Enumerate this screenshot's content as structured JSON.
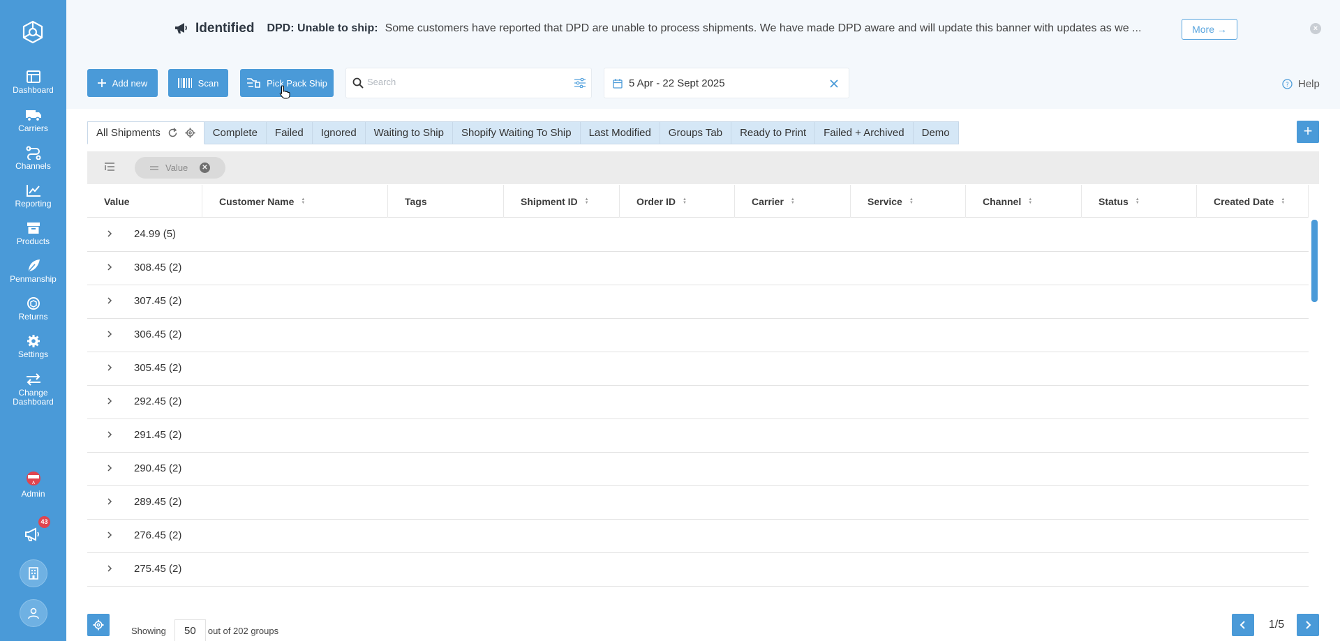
{
  "sidebar": {
    "items": [
      {
        "label": "Dashboard",
        "icon": "dashboard-icon"
      },
      {
        "label": "Carriers",
        "icon": "truck-icon"
      },
      {
        "label": "Channels",
        "icon": "channels-icon"
      },
      {
        "label": "Reporting",
        "icon": "chart-line-icon"
      },
      {
        "label": "Products",
        "icon": "box-icon"
      },
      {
        "label": "Penmanship",
        "icon": "feather-icon"
      },
      {
        "label": "Returns",
        "icon": "returns-icon"
      },
      {
        "label": "Settings",
        "icon": "gear-icon"
      },
      {
        "label": "Change Dashboard",
        "icon": "swap-icon"
      }
    ],
    "admin_label": "Admin",
    "notification_count": "43"
  },
  "banner": {
    "title": "Identified",
    "subtitle": "DPD: Unable to ship:",
    "text": "Some customers have reported that DPD are unable to process shipments. We have made DPD aware and will update this banner with updates as we ...",
    "more_label": "More →",
    "close_label": "×"
  },
  "toolbar": {
    "add_new_label": "Add new",
    "scan_label": "Scan",
    "pick_pack_ship_label": "Pick Pack Ship",
    "search_placeholder": "Search",
    "date_range": "5 Apr - 22 Sept 2025",
    "help_label": "Help"
  },
  "tabs": [
    {
      "label": "All Shipments"
    },
    {
      "label": "Complete"
    },
    {
      "label": "Failed"
    },
    {
      "label": "Ignored"
    },
    {
      "label": "Waiting to Ship"
    },
    {
      "label": "Shopify Waiting To Ship"
    },
    {
      "label": "Last Modified"
    },
    {
      "label": "Groups Tab"
    },
    {
      "label": "Ready to Print"
    },
    {
      "label": "Failed + Archived"
    },
    {
      "label": "Demo"
    }
  ],
  "add_tab_label": "+",
  "group_by": {
    "chip_label": "Value"
  },
  "table": {
    "columns": [
      "Value",
      "Customer Name",
      "Tags",
      "Shipment ID",
      "Order ID",
      "Carrier",
      "Service",
      "Channel",
      "Status",
      "Created Date"
    ],
    "rows": [
      "24.99 (5)",
      "308.45 (2)",
      "307.45 (2)",
      "306.45 (2)",
      "305.45 (2)",
      "292.45 (2)",
      "291.45 (2)",
      "290.45 (2)",
      "289.45 (2)",
      "276.45 (2)",
      "275.45 (2)"
    ]
  },
  "footer": {
    "showing_label": "Showing",
    "page_size": "50",
    "total_text": "out of 202 groups",
    "page": "1/5"
  },
  "colors": {
    "primary": "#4a9ad8",
    "banner_bg": "#f4f8fc",
    "tab_inactive": "#d5e7f6",
    "badge_red": "#e0454f"
  }
}
